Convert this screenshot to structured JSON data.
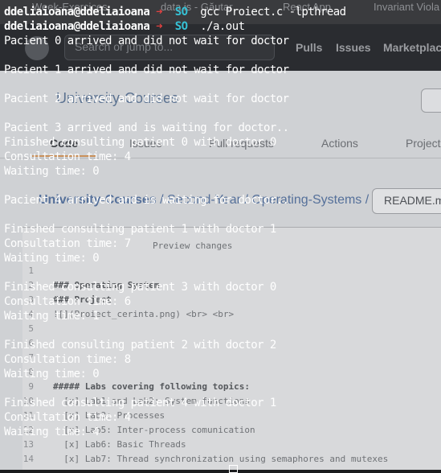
{
  "background": {
    "tabs": [
      "Week-Exercices",
      "data is - Găutar",
      "React App",
      "Invariant Viola"
    ],
    "header": {
      "search_placeholder": "Search or jump to...",
      "nav": [
        "Pulls",
        "Issues",
        "Marketplac"
      ]
    },
    "repo_title": "University-Courses",
    "repo_nav": [
      "Code",
      "Issues",
      "Pull requests",
      "Actions",
      "Project"
    ],
    "breadcrumb": {
      "parts": [
        "University-Courses",
        "Second-Year",
        "Operating-Systems"
      ],
      "separator": "/"
    },
    "readme_button": "README.m",
    "editor_lines": [
      {
        "num": "",
        "text": "Preview changes",
        "bold": false
      },
      {
        "num": "1",
        "text": "",
        "bold": false
      },
      {
        "num": "2",
        "text": "### Operating System",
        "bold": true
      },
      {
        "num": "3",
        "text": "### Project",
        "bold": true
      },
      {
        "num": "4",
        "text": "![](Proiect_cerinta.png) <br> <br>",
        "bold": false
      },
      {
        "num": "5",
        "text": "",
        "bold": false
      },
      {
        "num": "6",
        "text": "",
        "bold": false
      },
      {
        "num": "7",
        "text": "",
        "bold": false
      },
      {
        "num": "8",
        "text": "",
        "bold": false
      },
      {
        "num": "9",
        "text": "##### Labs covering following topics:",
        "bold": true
      },
      {
        "num": "10",
        "text": "  [x] Lab1 and Lab2: System functions",
        "bold": false
      },
      {
        "num": "11",
        "text": "  [x] Lab3: Processes",
        "bold": false
      },
      {
        "num": "12",
        "text": "  [x] Lab5: Inter-process comunication",
        "bold": false
      },
      {
        "num": "13",
        "text": "  [x] Lab6: Basic Threads",
        "bold": false
      },
      {
        "num": "14",
        "text": "  [x] Lab7: Thread synchronization using semaphores and mutexes",
        "bold": false
      }
    ]
  },
  "terminal": {
    "prompt_user": "ddeliaioana@ddeliaioana",
    "prompt_arrow": "➜",
    "prompt_dir": "SO",
    "commands": [
      "gcc Proiect.c -lpthread",
      "./a.out"
    ],
    "output_lines": [
      "Pacient 0 arrived and did not wait for doctor",
      "",
      "Pacient 1 arrived and did not wait for doctor",
      "",
      "Pacient 2 arrived and did not wait for doctor",
      "",
      "Pacient 3 arrived and is waiting for doctor..",
      "Finished consulting patient 0 with doctor 0",
      "Consultation time: 4",
      "Waiting time: 0",
      "",
      "Pacient 4 arrived and is waiting for doctor..",
      "",
      "Finished consulting patient 1 with doctor 1",
      "Consultation time: 7",
      "Waiting time: 0",
      "",
      "Finished consulting patient 3 with doctor 0",
      "Consultation time: 6",
      "Waiting time: 1",
      "",
      "Finished consulting patient 2 with doctor 2",
      "Consultation time: 8",
      "Waiting time: 0",
      "",
      "Finished consulting patient 4 with doctor 1",
      "Consultation time: 4",
      "Waiting time: 4"
    ]
  }
}
